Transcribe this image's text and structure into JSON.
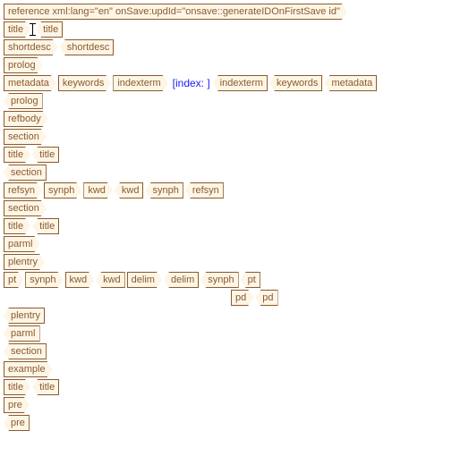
{
  "reference_attrs": "reference xml:lang=\"en\" onSave:updId=\"onsave::generateIDOnFirstSave id\"",
  "t": {
    "title": "title",
    "shortdesc": "shortdesc",
    "prolog": "prolog",
    "metadata": "metadata",
    "keywords": "keywords",
    "indexterm": "indexterm",
    "refbody": "refbody",
    "section": "section",
    "refsyn": "refsyn",
    "synph": "synph",
    "kwd": "kwd",
    "parml": "parml",
    "plentry": "plentry",
    "pt": "pt",
    "delim": "delim",
    "pd": "pd",
    "example": "example",
    "pre": "pre"
  },
  "index_label": "[index: ]"
}
